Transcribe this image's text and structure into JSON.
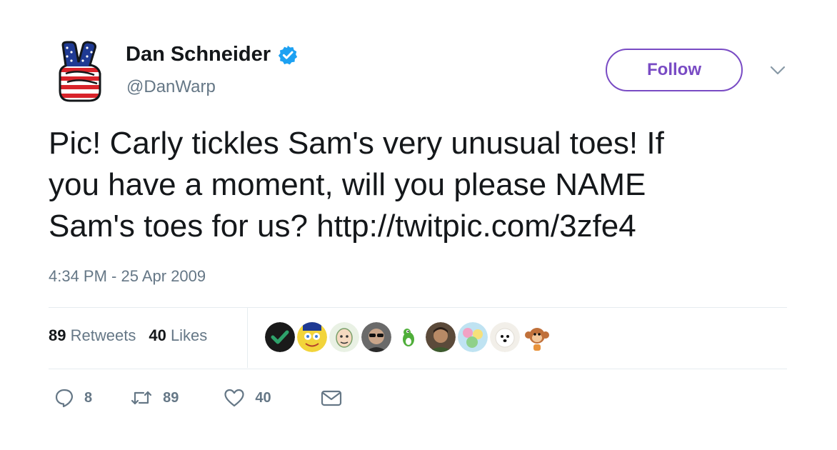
{
  "user": {
    "name": "Dan Schneider",
    "handle": "@DanWarp",
    "verified": true,
    "avatar": "peace-sign-flag-hand-icon"
  },
  "follow_label": "Follow",
  "tweet": {
    "lines": [
      "Pic! Carly tickles Sam's very unusual toes! If",
      "you have a moment, will you please NAME",
      "Sam's toes for us?  http://twitpic.com/3zfe4"
    ],
    "timestamp": "4:34 PM - 25 Apr 2009"
  },
  "stats": {
    "retweets_count": "89",
    "retweets_label": "Retweets",
    "likes_count": "40",
    "likes_label": "Likes"
  },
  "likers": [
    {
      "icon": "checkmark-avatar-icon",
      "color": "#1a1a1a"
    },
    {
      "icon": "spongebob-avatar-icon",
      "color": "#f2d43a"
    },
    {
      "icon": "cartoon-avatar-icon",
      "color": "#cfe3c4"
    },
    {
      "icon": "person-sunglasses-avatar-icon",
      "color": "#6a6a6a"
    },
    {
      "icon": "yoshi-avatar-icon",
      "color": "#4fae3a"
    },
    {
      "icon": "person-avatar-icon",
      "color": "#5b4a3a"
    },
    {
      "icon": "colorful-avatar-icon",
      "color": "#9fd0e8"
    },
    {
      "icon": "white-dog-avatar-icon",
      "color": "#f0ece6"
    },
    {
      "icon": "monkey-avatar-icon",
      "color": "#e8923a"
    }
  ],
  "actions": {
    "replies": "8",
    "retweets": "89",
    "likes": "40"
  },
  "colors": {
    "accent": "#794bc4",
    "verified": "#1da1f2",
    "secondary_text": "#657786"
  }
}
